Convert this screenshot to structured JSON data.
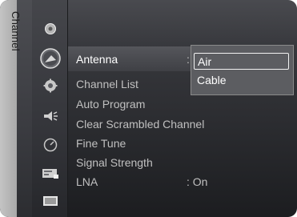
{
  "sidebar": {
    "title": "Channel"
  },
  "menu": {
    "items": [
      {
        "label": "Antenna",
        "value": ":"
      },
      {
        "label": "Channel List",
        "value": ""
      },
      {
        "label": "Auto Program",
        "value": ""
      },
      {
        "label": "Clear Scrambled Channel",
        "value": ""
      },
      {
        "label": "Fine Tune",
        "value": ""
      },
      {
        "label": "Signal Strength",
        "value": ""
      },
      {
        "label": "LNA",
        "value": ": On"
      }
    ],
    "selected_index": 0
  },
  "popup": {
    "options": [
      "Air",
      "Cable"
    ],
    "highlighted_index": 0
  },
  "icons": [
    "input-icon",
    "channel-icon",
    "setup-icon",
    "sound-icon",
    "clock-icon",
    "picture-icon",
    "display-icon"
  ],
  "colors": {
    "accent_text": "#ffffff",
    "dim_text": "#c0c0c0",
    "popup_bg": "#5c5d61"
  }
}
